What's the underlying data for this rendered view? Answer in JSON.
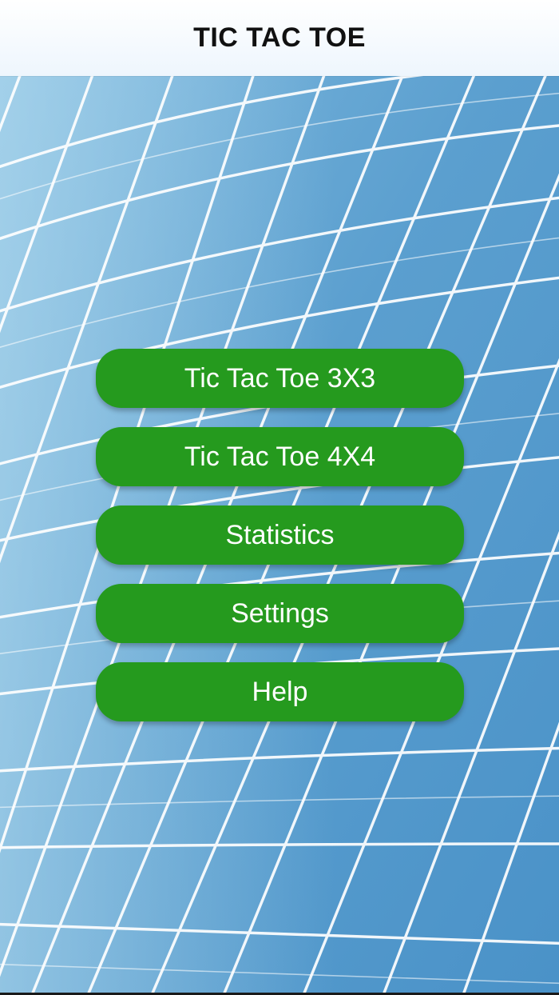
{
  "header": {
    "title": "TIC TAC TOE"
  },
  "menu": {
    "buttons": [
      {
        "label": "Tic Tac Toe 3X3"
      },
      {
        "label": "Tic Tac Toe 4X4"
      },
      {
        "label": "Statistics"
      },
      {
        "label": "Settings"
      },
      {
        "label": "Help"
      }
    ]
  },
  "colors": {
    "button_green": "#259a1e",
    "background_blue": "#5fa3d1",
    "grid_lines": "#ffffff",
    "header_bg": "#ffffff"
  }
}
